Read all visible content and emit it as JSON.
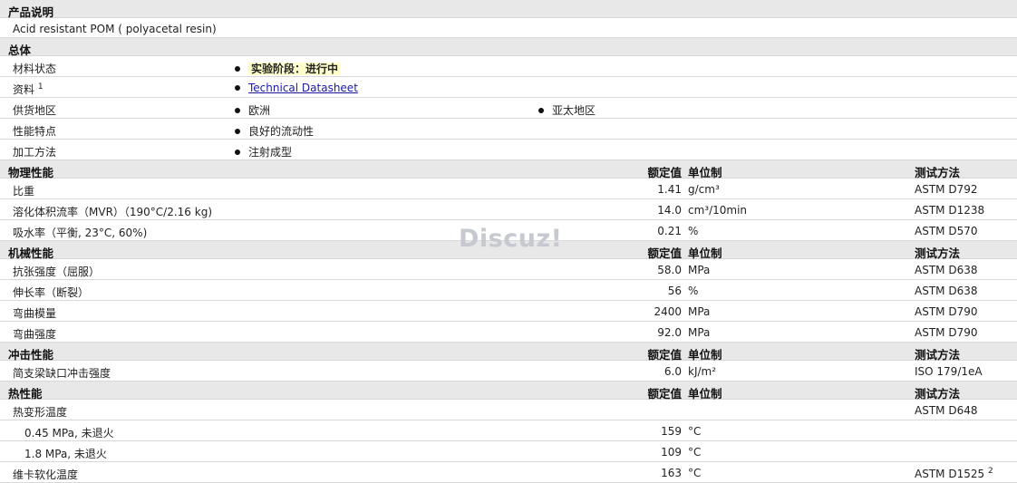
{
  "sections": {
    "description": {
      "title": "产品说明",
      "text": "Acid resistant POM ( polyacetal resin)"
    },
    "general": {
      "title": "总体",
      "material_status_label": "材料状态",
      "material_status_value": "实验阶段：进行中",
      "info_label": "资料",
      "info_sup": "1",
      "info_link": "Technical Datasheet",
      "supply_label": "供货地区",
      "supply_1": "欧洲",
      "supply_2": "亚太地区",
      "features_label": "性能特点",
      "features_value": "良好的流动性",
      "processing_label": "加工方法",
      "processing_value": "注射成型"
    },
    "headers": {
      "value": "额定值",
      "unit": "单位制",
      "method": "测试方法"
    },
    "physical": {
      "title": "物理性能",
      "rows": [
        {
          "label": "比重",
          "value": "1.41",
          "unit": "g/cm³",
          "method": "ASTM D792"
        },
        {
          "label": "溶化体积流率（MVR）（190°C/2.16 kg)",
          "value": "14.0",
          "unit": "cm³/10min",
          "method": "ASTM D1238"
        },
        {
          "label": "吸水率（平衡, 23°C, 60%)",
          "value": "0.21",
          "unit": "%",
          "method": "ASTM D570"
        }
      ]
    },
    "mechanical": {
      "title": "机械性能",
      "rows": [
        {
          "label": "抗张强度（屈服）",
          "value": "58.0",
          "unit": "MPa",
          "method": "ASTM D638"
        },
        {
          "label": "伸长率（断裂）",
          "value": "56",
          "unit": "%",
          "method": "ASTM D638"
        },
        {
          "label": "弯曲模量",
          "value": "2400",
          "unit": "MPa",
          "method": "ASTM D790"
        },
        {
          "label": "弯曲强度",
          "value": "92.0",
          "unit": "MPa",
          "method": "ASTM D790"
        }
      ]
    },
    "impact": {
      "title": "冲击性能",
      "rows": [
        {
          "label": "简支梁缺口冲击强度",
          "value": "6.0",
          "unit": "kJ/m²",
          "method": "ISO 179/1eA"
        }
      ]
    },
    "thermal": {
      "title": "热性能",
      "hdt_label": "热变形温度",
      "hdt_method": "ASTM D648",
      "rows": [
        {
          "label": "0.45 MPa, 未退火",
          "value": "159",
          "unit": "°C"
        },
        {
          "label": "1.8 MPa, 未退火",
          "value": "109",
          "unit": "°C"
        }
      ],
      "vicat_label": "维卡软化温度",
      "vicat_value": "163",
      "vicat_unit": "°C",
      "vicat_method": "ASTM D1525",
      "vicat_sup": "2"
    }
  },
  "watermark": "Discuz!"
}
